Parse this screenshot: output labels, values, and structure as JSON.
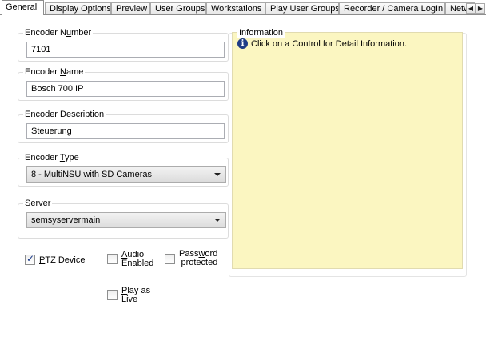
{
  "tabs": [
    {
      "label": "General",
      "active": true
    },
    {
      "label": "Display Options"
    },
    {
      "label": "Preview"
    },
    {
      "label": "User Groups"
    },
    {
      "label": "Workstations"
    },
    {
      "label": "Play User Groups"
    },
    {
      "label": "Recorder / Camera LogIn"
    },
    {
      "label": "Netw"
    }
  ],
  "tab_scroll": {
    "left_glyph": "◀",
    "right_glyph": "▶"
  },
  "encoder_number": {
    "legend": "Encoder Number",
    "value": "7101"
  },
  "encoder_name": {
    "legend": "Encoder Name",
    "value": "Bosch 700 IP"
  },
  "encoder_description": {
    "legend": "Encoder Description",
    "value": "Steuerung"
  },
  "encoder_type": {
    "legend": "Encoder Type",
    "value": "8 - MultiNSU with SD Cameras"
  },
  "server": {
    "legend": "Server",
    "value": "semsyservermain"
  },
  "checkboxes": {
    "ptz": {
      "label": "PTZ Device",
      "checked": true
    },
    "audio": {
      "label_line1": "Audio",
      "label_line2": "Enabled",
      "checked": false
    },
    "password": {
      "label_line1": "Password",
      "label_line2": "protected",
      "checked": false
    },
    "play_live": {
      "label_line1": "Play as",
      "label_line2": "Live",
      "checked": false
    }
  },
  "information": {
    "legend": "Information",
    "text": "Click on a Control for Detail Information.",
    "icon": "info-icon"
  },
  "colors": {
    "info_bg": "#fbf6c1",
    "check_mark": "#1b3a8a"
  }
}
